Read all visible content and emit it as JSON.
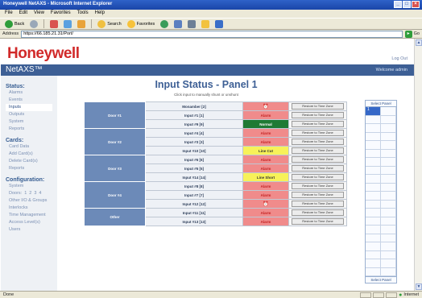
{
  "window": {
    "title": "Honeywell NetAXS - Microsoft Internet Explorer",
    "controls": [
      "_",
      "□",
      "×"
    ]
  },
  "menu": [
    "File",
    "Edit",
    "View",
    "Favorites",
    "Tools",
    "Help"
  ],
  "toolbar": {
    "back": "Back",
    "search": "Search",
    "favorites": "Favorites"
  },
  "address": {
    "label": "Address",
    "url": "https://66.185.21.31/Port/",
    "go": "Go"
  },
  "brand": {
    "logo": "Honeywell",
    "product": "NetAXS™",
    "logout": "Log Out",
    "welcome": "Welcome admin"
  },
  "sidebar": {
    "status_head": "Status:",
    "status_items": [
      "Alarms",
      "Events",
      "Inputs",
      "Outputs",
      "System",
      "Reports"
    ],
    "cards_head": "Cards:",
    "cards_items": [
      "Card Data",
      "Add Card(s)",
      "Delete Card(s)",
      "Reports"
    ],
    "config_head": "Configuration:",
    "config_items_top": [
      "System"
    ],
    "doors_label": "Doors:",
    "doors": [
      "1",
      "2",
      "3",
      "4"
    ],
    "config_items_bottom": [
      "Other I/O & Groups",
      "Interlocks",
      "Time Management",
      "Access Level(s)",
      "Users"
    ]
  },
  "main": {
    "title": "Input Status - Panel 1",
    "subtitle": "Click input to manually shunt or unshunt",
    "reset_label": "Restore to Time Zone",
    "groups": [
      {
        "door": "Door #1",
        "rows": [
          {
            "input": "Monamber [2]",
            "state": "",
            "type": "alarm-bell"
          },
          {
            "input": "Input #1 [1]",
            "state": "Alarm",
            "type": "alarm"
          },
          {
            "input": "Input #9 [9]",
            "state": "Normal",
            "type": "normal"
          }
        ]
      },
      {
        "door": "Door #2",
        "rows": [
          {
            "input": "Input #4 [4]",
            "state": "Alarm",
            "type": "alarm"
          },
          {
            "input": "Input #3 [3]",
            "state": "Alarm",
            "type": "alarm"
          },
          {
            "input": "Input #10 [10]",
            "state": "Line Cut",
            "type": "line-cut"
          }
        ]
      },
      {
        "door": "Door #3",
        "rows": [
          {
            "input": "Input #6 [6]",
            "state": "Alarm",
            "type": "alarm"
          },
          {
            "input": "Input #5 [5]",
            "state": "Alarm",
            "type": "alarm"
          },
          {
            "input": "Input #14 [14]",
            "state": "Line Short",
            "type": "line-short"
          }
        ]
      },
      {
        "door": "Door #4",
        "rows": [
          {
            "input": "Input #8 [8]",
            "state": "Alarm",
            "type": "alarm"
          },
          {
            "input": "Input #7 [7]",
            "state": "Alarm",
            "type": "alarm"
          },
          {
            "input": "Input #12 [12]",
            "state": "",
            "type": "alarm-bell"
          }
        ]
      },
      {
        "door": "Other",
        "rows": [
          {
            "input": "Input #11 [11]",
            "state": "Alarm",
            "type": "alarm"
          },
          {
            "input": "Input #13 [13]",
            "state": "Alarm",
            "type": "alarm"
          }
        ]
      }
    ]
  },
  "panel_selector": {
    "header": "Select Panel",
    "footer": "Select Panel",
    "selected": "1"
  },
  "statusbar": {
    "left": "Done",
    "zone": "Internet"
  },
  "colors": {
    "brand_red": "#d12a2a",
    "header_blue": "#3d5f95",
    "alarm": "#f08b8b",
    "normal": "#1f7a34",
    "warn_yellow": "#f7f259"
  }
}
